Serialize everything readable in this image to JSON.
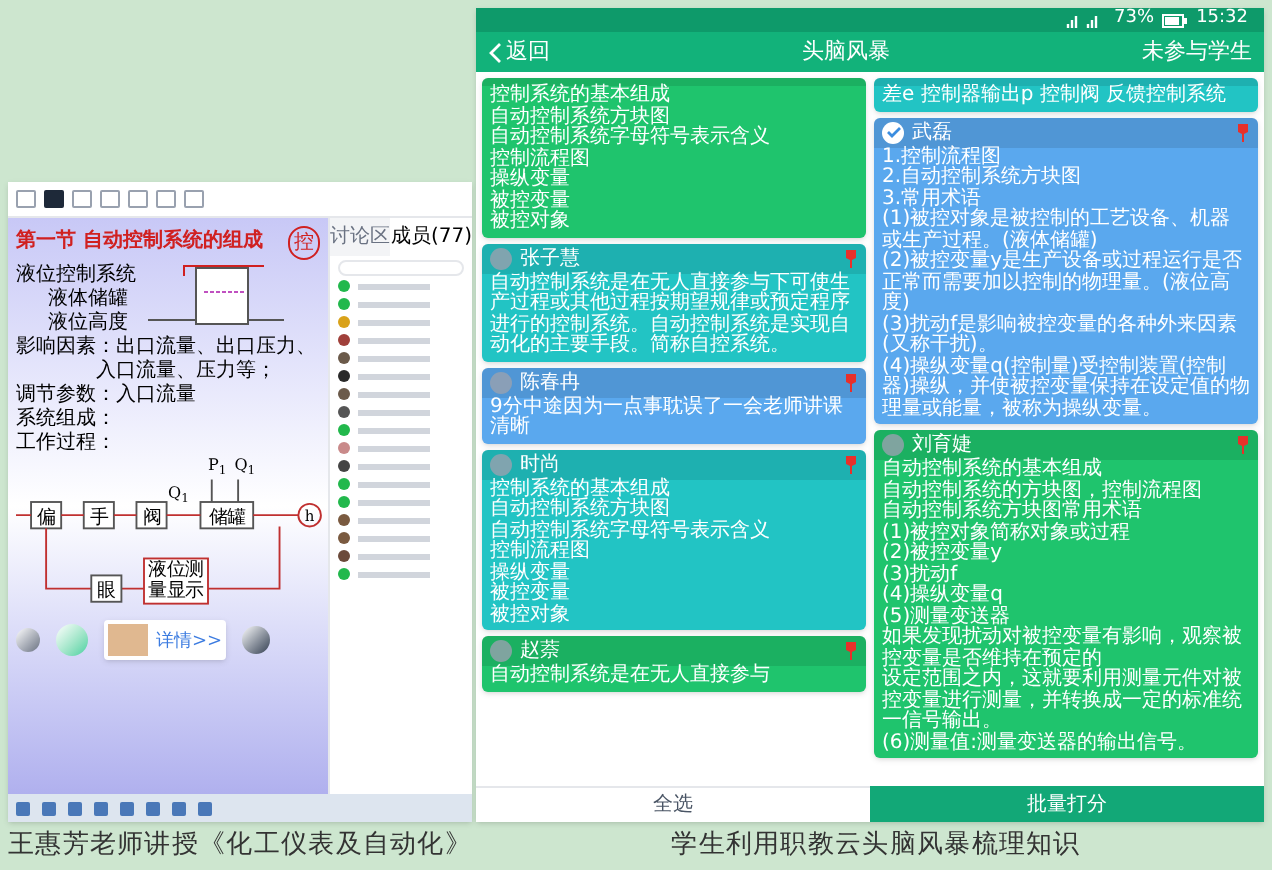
{
  "recording": {
    "slide": {
      "title": "第一节  自动控制系统的组成",
      "lines": [
        {
          "kind": "main",
          "text": "液位控制系统"
        },
        {
          "kind": "sub",
          "text": "液体储罐"
        },
        {
          "kind": "sub",
          "text": "液位高度"
        },
        {
          "kind": "main",
          "text": "影响因素：出口流量、出口压力、"
        },
        {
          "kind": "sub",
          "text": "入口流量、压力等；"
        },
        {
          "kind": "main",
          "text": "调节参数：入口流量"
        },
        {
          "kind": "main",
          "text": "系统组成："
        },
        {
          "kind": "main",
          "text": "工作过程："
        }
      ],
      "annotation_label": "控",
      "blocks": [
        "偏",
        "手",
        "阀",
        "储罐"
      ],
      "feedback_blocks": [
        "眼",
        "液位测量显示"
      ],
      "disturbances": [
        "P$_{1}$",
        "Q$_{1}$"
      ],
      "flow_label": "Q$_{1}$",
      "output_label": "h",
      "popup": {
        "link": "详情>>"
      }
    },
    "sidebar": {
      "tabs": [
        {
          "label": "讨论区",
          "selected": false
        },
        {
          "label": "成员(77)",
          "selected": true
        }
      ],
      "members": [
        {
          "color": "#22b84c"
        },
        {
          "color": "#22b84c"
        },
        {
          "color": "#d9a21a"
        },
        {
          "color": "#a0403a"
        },
        {
          "color": "#6b5a4a"
        },
        {
          "color": "#2a2a2a"
        },
        {
          "color": "#6b5a4a"
        },
        {
          "color": "#555555"
        },
        {
          "color": "#22b84c"
        },
        {
          "color": "#c98a8a"
        },
        {
          "color": "#444444"
        },
        {
          "color": "#22b84c"
        },
        {
          "color": "#22b84c"
        },
        {
          "color": "#7a5a40"
        },
        {
          "color": "#7a5a40"
        },
        {
          "color": "#6b4a3a"
        },
        {
          "color": "#22b84c"
        }
      ]
    }
  },
  "phone": {
    "status": {
      "battery": "73%",
      "time": "15:32"
    },
    "header": {
      "back": "返回",
      "title": "头脑风暴",
      "action": "未参与学生"
    },
    "columns": [
      [
        {
          "color": "#1fc46d",
          "lines": [
            "控制系统的基本组成",
            "自动控制系统方块图",
            "自动控制系统字母符号表示含义",
            "控制流程图",
            "操纵变量",
            "被控变量",
            "被控对象"
          ]
        },
        {
          "color": "#22c4c4",
          "name": "张子慧",
          "checked": false,
          "pinned": true,
          "lines": [
            "自动控制系统是在无人直接参与下可使生产过程或其他过程按期望规律或预定程序进行的控制系统。自动控制系统是实现自动化的主要手段。简称自控系统。"
          ]
        },
        {
          "color": "#5aa8ee",
          "name": "陈春冉",
          "checked": false,
          "pinned": true,
          "lines": [
            "9分中途因为一点事耽误了一会老师讲课清晰"
          ]
        },
        {
          "color": "#22c4c4",
          "name": "时尚",
          "checked": false,
          "pinned": true,
          "lines": [
            "控制系统的基本组成",
            "自动控制系统方块图",
            "自动控制系统字母符号表示含义",
            "控制流程图",
            "操纵变量",
            "被控变量",
            "被控对象"
          ]
        },
        {
          "color": "#1fc46d",
          "name": "赵萘",
          "checked": false,
          "pinned": true,
          "lines": [
            "自动控制系统是在无人直接参与"
          ]
        }
      ],
      [
        {
          "color": "#22c4c4",
          "lines": [
            "差e 控制器输出p 控制阀 反馈控制系统"
          ]
        },
        {
          "color": "#5aa8ee",
          "name": "武磊",
          "checked": true,
          "pinned": true,
          "lines": [
            "1.控制流程图",
            "2.自动控制系统方块图",
            "3.常用术语",
            "(1)被控对象是被控制的工艺设备、机器或生产过程。(液体储罐)",
            "(2)被控变量y是生产设备或过程运行是否正常而需要加以控制的物理量。(液位高度)",
            "(3)扰动f是影响被控变量的各种外来因素(又称干扰)。",
            "(4)操纵变量q(控制量)受控制装置(控制器)操纵，并使被控变量保持在设定值的物理量或能量，被称为操纵变量。"
          ]
        },
        {
          "color": "#1fc46d",
          "name": "刘育婕",
          "checked": false,
          "pinned": true,
          "lines": [
            "自动控制系统的基本组成",
            "自动控制系统的方块图，控制流程图",
            "自动控制系统方块图常用术语",
            "(1)被控对象简称对象或过程",
            "(2)被控变量y",
            "(3)扰动f",
            "(4)操纵变量q",
            "(5)测量变送器",
            "如果发现扰动对被控变量有影响，观察被控变量是否维持在预定的",
            "设定范围之内，这就要利用测量元件对被控变量进行测量，并转换成一定的标准统一信号输出。",
            "(6)测量值:测量变送器的输出信号。"
          ]
        }
      ]
    ],
    "footer": {
      "select_all": "全选",
      "batch": "批量打分"
    }
  },
  "captions": [
    "王惠芳老师讲授《化工仪表及自动化》",
    "学生利用职教云头脑风暴梳理知识"
  ]
}
